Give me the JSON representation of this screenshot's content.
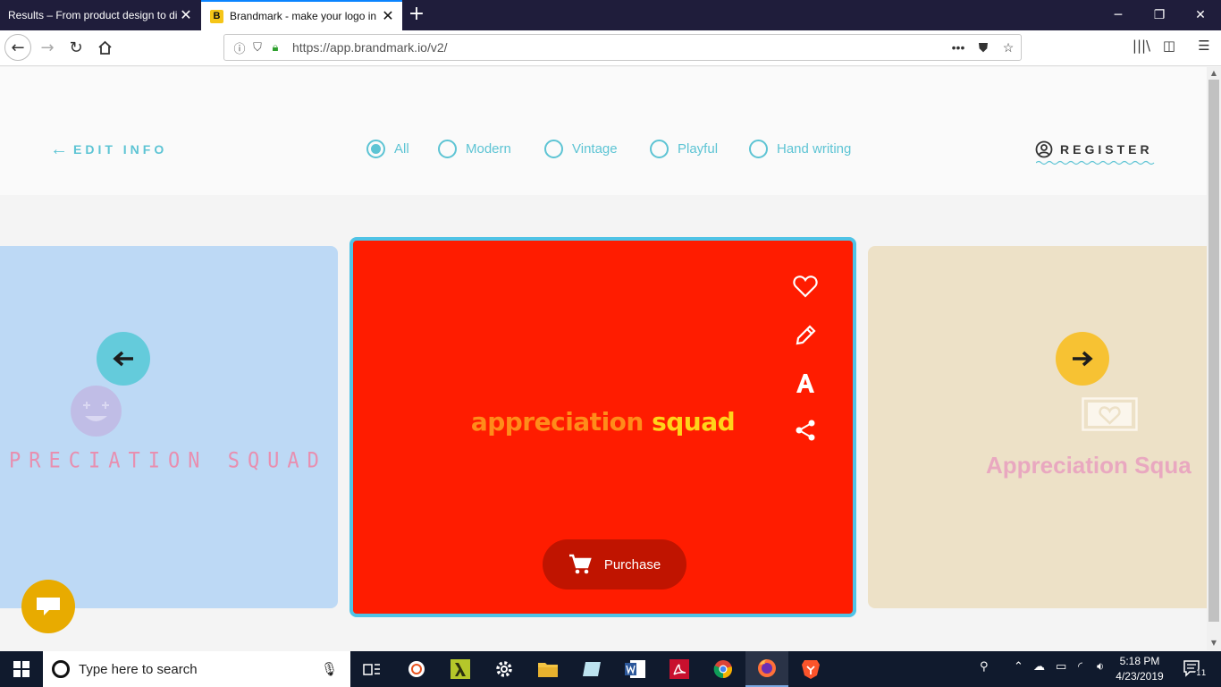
{
  "browser": {
    "tabs": [
      {
        "title": "Results – From product design to di",
        "active": false
      },
      {
        "title": "Brandmark - make your logo in",
        "active": true,
        "favicon": "B"
      }
    ],
    "url": "https://app.brandmark.io/v2/"
  },
  "header": {
    "edit_info": "EDIT INFO",
    "filters": [
      {
        "label": "All",
        "checked": true
      },
      {
        "label": "Modern",
        "checked": false
      },
      {
        "label": "Vintage",
        "checked": false
      },
      {
        "label": "Playful",
        "checked": false
      },
      {
        "label": "Hand writing",
        "checked": false
      }
    ],
    "register": "REGISTER"
  },
  "cards": {
    "left": {
      "wordmark": "PRECIATION SQUAD",
      "bg": "#bdd9f5",
      "text_color": "#e88fb0"
    },
    "center": {
      "wordmark_part1": "appreciation",
      "wordmark_part2": "squad",
      "bg": "#ff1c00",
      "color1": "#ff8c1a",
      "color2": "#ffd31a",
      "actions": [
        "heart-icon",
        "pencil-icon",
        "font-icon",
        "share-icon"
      ],
      "purchase_label": "Purchase"
    },
    "right": {
      "wordmark": "Appreciation Squa",
      "bg": "#ede1c7",
      "text_color": "#e9a8c0"
    }
  },
  "colors": {
    "accent": "#5dc4d4",
    "prev_nav": "#64cbdb",
    "next_nav": "#f7c233",
    "chat": "#e8ab00",
    "selected_border": "#4fc3e6"
  },
  "taskbar": {
    "search_placeholder": "Type here to search",
    "time": "5:18 PM",
    "date": "4/23/2019",
    "notification_count": "11"
  }
}
